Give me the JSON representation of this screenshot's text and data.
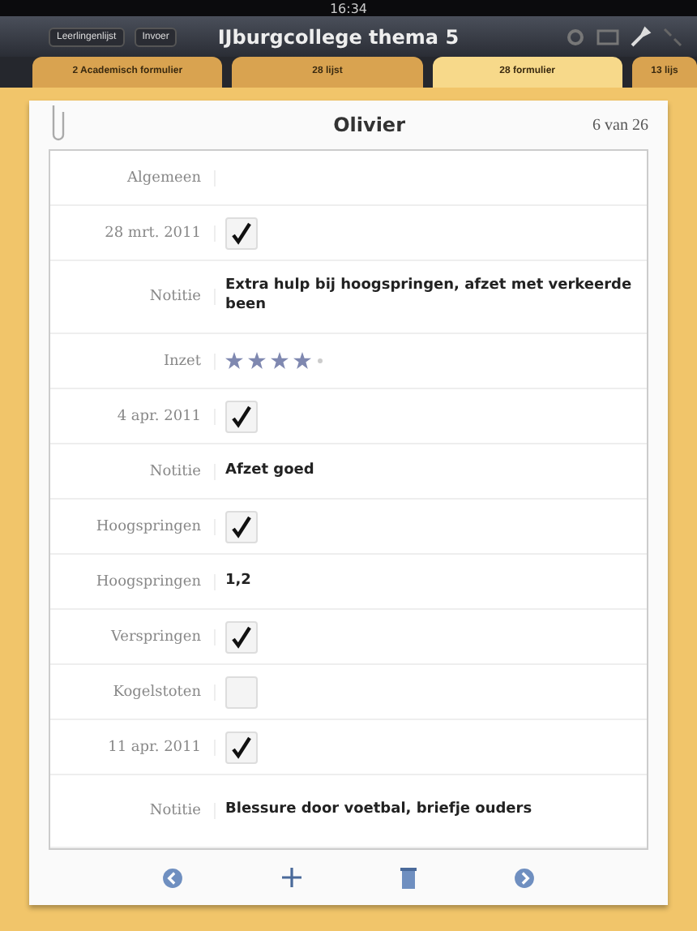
{
  "status_bar": {
    "time": "16:34"
  },
  "nav_bar": {
    "title": "IJburgcollege thema 5",
    "buttons": [
      "Leerlingenlijst",
      "Invoer"
    ]
  },
  "tabs": [
    {
      "label": "2 Academisch formulier",
      "selected": false
    },
    {
      "label": "28 lijst",
      "selected": false
    },
    {
      "label": "28 formulier",
      "selected": true
    },
    {
      "label": "13 lijs",
      "selected": false
    }
  ],
  "record": {
    "title": "Olivier",
    "position": "6 van 26"
  },
  "rows": [
    {
      "kind": "section",
      "label": "Algemeen"
    },
    {
      "kind": "check",
      "label": "28 mrt. 2011",
      "checked": true
    },
    {
      "kind": "note",
      "label": "Notitie",
      "value": "Extra hulp bij hoogspringen, afzet met verkeerde been"
    },
    {
      "kind": "stars",
      "label": "Inzet",
      "stars": 4
    },
    {
      "kind": "check",
      "label": "4 apr. 2011",
      "checked": true
    },
    {
      "kind": "note",
      "label": "Notitie",
      "value": "Afzet goed"
    },
    {
      "kind": "check",
      "label": "Hoogspringen",
      "checked": true
    },
    {
      "kind": "note",
      "label": "Hoogspringen",
      "value": "1,2"
    },
    {
      "kind": "check",
      "label": "Verspringen",
      "checked": true
    },
    {
      "kind": "check",
      "label": "Kogelstoten",
      "checked": false
    },
    {
      "kind": "check",
      "label": "11 apr. 2011",
      "checked": true
    },
    {
      "kind": "note",
      "label": "Notitie",
      "value": "Blessure door voetbal, briefje ouders"
    }
  ]
}
